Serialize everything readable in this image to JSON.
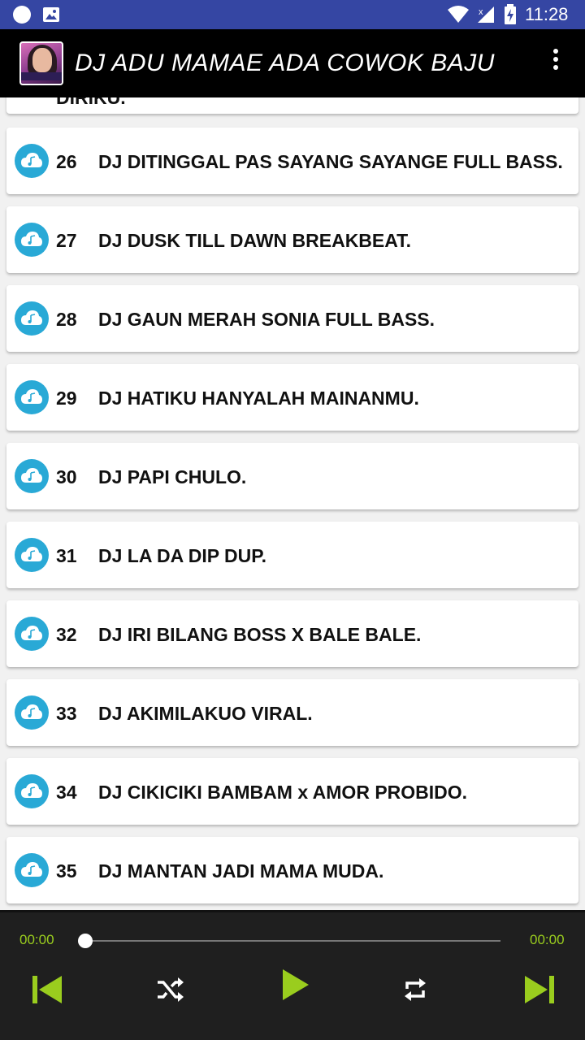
{
  "status_bar": {
    "time": "11:28"
  },
  "app_bar": {
    "title": "DJ ADU MAMAE ADA COWOK BAJU",
    "logo": "app-logo-artwork",
    "menu_icon": "overflow-menu-icon"
  },
  "song_list": {
    "partial_title": "DIRIKU.",
    "items": [
      {
        "number": "26",
        "title": "DJ DITINGGAL PAS SAYANG SAYANGE FULL BASS."
      },
      {
        "number": "27",
        "title": "DJ DUSK TILL DAWN BREAKBEAT."
      },
      {
        "number": "28",
        "title": "DJ GAUN MERAH SONIA FULL BASS."
      },
      {
        "number": "29",
        "title": "DJ HATIKU HANYALAH MAINANMU."
      },
      {
        "number": "30",
        "title": "DJ PAPI CHULO."
      },
      {
        "number": "31",
        "title": "DJ LA DA DIP DUP."
      },
      {
        "number": "32",
        "title": "DJ IRI BILANG BOSS X BALE BALE."
      },
      {
        "number": "33",
        "title": "DJ AKIMILAKUO VIRAL."
      },
      {
        "number": "34",
        "title": "DJ CIKICIKI BAMBAM x AMOR PROBIDO."
      },
      {
        "number": "35",
        "title": "DJ MANTAN JADI MAMA MUDA."
      }
    ]
  },
  "player": {
    "time_elapsed": "00:00",
    "time_total": "00:00",
    "progress": 0,
    "accent_color": "#9acd1e",
    "controls": [
      "skip-previous-icon",
      "shuffle-icon",
      "play-icon",
      "repeat-icon",
      "skip-next-icon"
    ]
  }
}
